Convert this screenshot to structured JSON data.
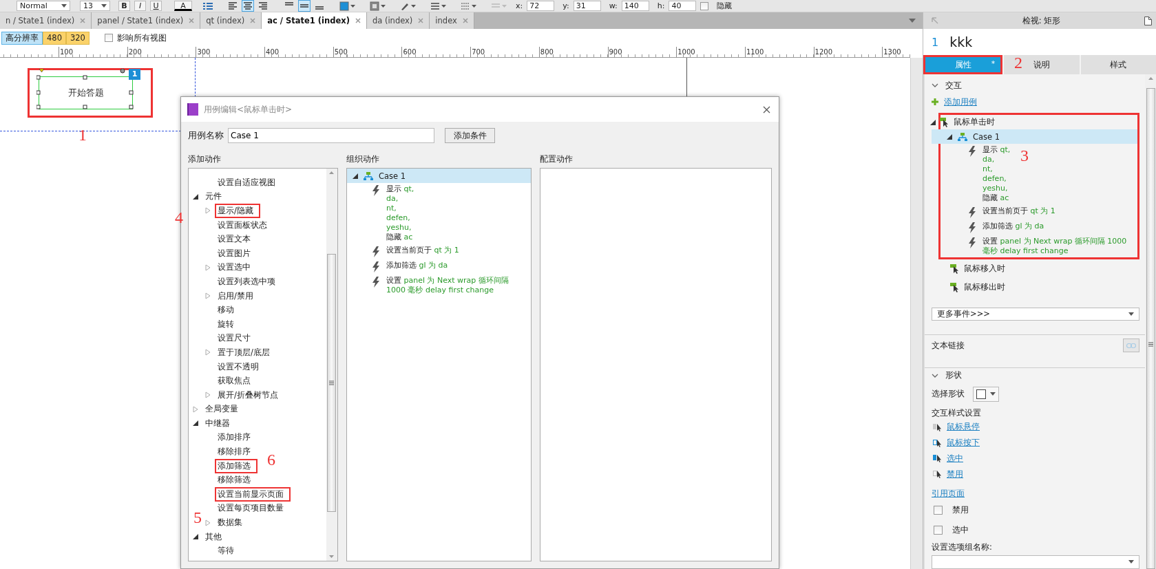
{
  "toolbar": {
    "style": "Normal",
    "font_size": "13",
    "format_buttons": [
      "B",
      "I",
      "U"
    ],
    "text_color_label": "A",
    "align_buttons": [
      {
        "selected": false
      },
      {
        "selected": true
      },
      {
        "selected": false
      }
    ],
    "valign_buttons": [
      {
        "selected": false
      },
      {
        "selected": true
      },
      {
        "selected": false
      }
    ],
    "geometry": [
      {
        "label": "x:",
        "value": "72"
      },
      {
        "label": "y:",
        "value": "31"
      },
      {
        "label": "w:",
        "value": "140"
      },
      {
        "label": "h:",
        "value": "40"
      }
    ],
    "hidden": {
      "label": "隐藏",
      "checked": false
    }
  },
  "tabs": [
    {
      "label": "n / State1 (index)",
      "selected": false
    },
    {
      "label": "panel / State1 (index)",
      "selected": false
    },
    {
      "label": "qt (index)",
      "selected": false
    },
    {
      "label": "ac / State1 (index)",
      "selected": true
    },
    {
      "label": "da (index)",
      "selected": false
    },
    {
      "label": "index",
      "selected": false
    }
  ],
  "adaptive_bar": {
    "views": [
      {
        "label": "高分辨率",
        "selected": true
      },
      {
        "label": "480",
        "selected": false
      },
      {
        "label": "320",
        "selected": false
      }
    ],
    "affect_all": {
      "label": "影响所有视图",
      "checked": false
    }
  },
  "ruler": {
    "ticks": [
      "100",
      "200",
      "300",
      "400",
      "500",
      "600",
      "700",
      "800",
      "900",
      "1000",
      "1100",
      "1200",
      "1300"
    ]
  },
  "canvas": {
    "widget": {
      "text": "开始答题",
      "badge": "1",
      "highlighted": true
    }
  },
  "dialog": {
    "title": "用例编辑<鼠标单击时>",
    "case_name_label": "用例名称",
    "case_name": "Case 1",
    "add_condition": "添加条件",
    "headings": [
      "添加动作",
      "组织动作",
      "配置动作"
    ],
    "action_tree": [
      {
        "children": [
          {
            "label": "设置自适应视图"
          }
        ]
      },
      {
        "label": "元件",
        "expanded": true,
        "children": [
          {
            "label": "显示/隐藏",
            "expanded": false,
            "highlighted": true
          },
          {
            "label": "设置面板状态"
          },
          {
            "label": "设置文本"
          },
          {
            "label": "设置图片"
          },
          {
            "label": "设置选中",
            "expanded": false
          },
          {
            "label": "设置列表选中项"
          },
          {
            "label": "启用/禁用",
            "expanded": false
          },
          {
            "label": "移动"
          },
          {
            "label": "旋转"
          },
          {
            "label": "设置尺寸"
          },
          {
            "label": "置于顶层/底层",
            "expanded": false
          },
          {
            "label": "设置不透明"
          },
          {
            "label": "获取焦点"
          },
          {
            "label": "展开/折叠树节点",
            "expanded": false
          }
        ]
      },
      {
        "label": "全局变量",
        "expanded": false
      },
      {
        "label": "中继器",
        "expanded": true,
        "children": [
          {
            "label": "添加排序"
          },
          {
            "label": "移除排序"
          },
          {
            "label": "添加筛选",
            "highlighted": true
          },
          {
            "label": "移除筛选"
          },
          {
            "label": "设置当前显示页面",
            "highlighted": true
          },
          {
            "label": "设置每页项目数量"
          },
          {
            "label": "数据集",
            "expanded": false
          }
        ]
      },
      {
        "label": "其他",
        "expanded": true,
        "children": [
          {
            "label": "等待"
          }
        ]
      }
    ],
    "case": {
      "label": "Case 1",
      "selected": true,
      "expanded": true,
      "actions": [
        {
          "lines": [
            [
              {
                "text": "显示 ",
                "kind": "verb"
              },
              {
                "text": "qt,",
                "kind": "target"
              }
            ],
            [
              {
                "text": "da,",
                "kind": "target"
              }
            ],
            [
              {
                "text": "nt,",
                "kind": "target"
              }
            ],
            [
              {
                "text": "defen,",
                "kind": "target"
              }
            ],
            [
              {
                "text": "yeshu,",
                "kind": "target"
              }
            ],
            [
              {
                "text": "隐藏 ",
                "kind": "verb"
              },
              {
                "text": "ac",
                "kind": "target"
              }
            ]
          ]
        },
        {
          "lines": [
            [
              {
                "text": "设置当前页于 ",
                "kind": "verb"
              },
              {
                "text": "qt 为 1",
                "kind": "target"
              }
            ]
          ]
        },
        {
          "lines": [
            [
              {
                "text": "添加筛选 ",
                "kind": "verb"
              },
              {
                "text": "gl 为 da",
                "kind": "target"
              }
            ]
          ]
        },
        {
          "lines": [
            [
              {
                "text": "设置 ",
                "kind": "verb"
              },
              {
                "text": "panel 为 Next wrap 循环间隔 1000 毫秒 delay first change",
                "kind": "target"
              }
            ]
          ]
        }
      ]
    }
  },
  "inspector": {
    "title": "检视: 矩形",
    "index": "1",
    "name": "kkk",
    "tabs": [
      {
        "label": "属性",
        "selected": true,
        "modified": "*",
        "highlighted": true
      },
      {
        "label": "说明",
        "selected": false
      },
      {
        "label": "样式",
        "selected": false
      }
    ],
    "interaction": {
      "heading": "交互",
      "expanded": true,
      "add_case": "添加用例",
      "events": [
        {
          "label": "鼠标单击时",
          "expanded": true,
          "highlighted": true,
          "cases": [
            {
              "label": "Case 1",
              "selected": true,
              "expanded": true,
              "actions": [
                {
                  "lines": [
                    [
                      {
                        "text": "显示 ",
                        "kind": "verb"
                      },
                      {
                        "text": "qt,",
                        "kind": "target"
                      }
                    ],
                    [
                      {
                        "text": "da,",
                        "kind": "target"
                      }
                    ],
                    [
                      {
                        "text": "nt,",
                        "kind": "target"
                      }
                    ],
                    [
                      {
                        "text": "defen,",
                        "kind": "target"
                      }
                    ],
                    [
                      {
                        "text": "yeshu,",
                        "kind": "target"
                      }
                    ],
                    [
                      {
                        "text": "隐藏 ",
                        "kind": "verb"
                      },
                      {
                        "text": "ac",
                        "kind": "target"
                      }
                    ]
                  ]
                },
                {
                  "lines": [
                    [
                      {
                        "text": "设置当前页于 ",
                        "kind": "verb"
                      },
                      {
                        "text": "qt 为 1",
                        "kind": "target"
                      }
                    ]
                  ]
                },
                {
                  "lines": [
                    [
                      {
                        "text": "添加筛选 ",
                        "kind": "verb"
                      },
                      {
                        "text": "gl 为 da",
                        "kind": "target"
                      }
                    ]
                  ]
                },
                {
                  "lines": [
                    [
                      {
                        "text": "设置 ",
                        "kind": "verb"
                      },
                      {
                        "text": "panel 为 Next wrap 循环间隔 1000 毫秒 delay first change",
                        "kind": "target"
                      }
                    ]
                  ]
                }
              ]
            }
          ]
        },
        {
          "label": "鼠标移入时",
          "highlighted": false
        },
        {
          "label": "鼠标移出时",
          "highlighted": false
        }
      ],
      "more_events": "更多事件>>>"
    },
    "text_link_label": "文本链接",
    "shape": {
      "heading": "形状",
      "expanded": true,
      "select_shape_label": "选择形状",
      "style_heading": "交互样式设置",
      "style_links": [
        {
          "label": "鼠标悬停",
          "kind": "hover"
        },
        {
          "label": "鼠标按下",
          "kind": "down"
        },
        {
          "label": "选中",
          "kind": "selected"
        },
        {
          "label": "禁用",
          "kind": "disabled"
        }
      ],
      "ref_page": "引用页面",
      "checkboxes": [
        {
          "label": "禁用",
          "checked": false
        },
        {
          "label": "选中",
          "checked": false
        }
      ],
      "group_name_label": "设置选项组名称:"
    }
  },
  "annotations": [
    "1",
    "2",
    "3",
    "4",
    "5",
    "6"
  ]
}
